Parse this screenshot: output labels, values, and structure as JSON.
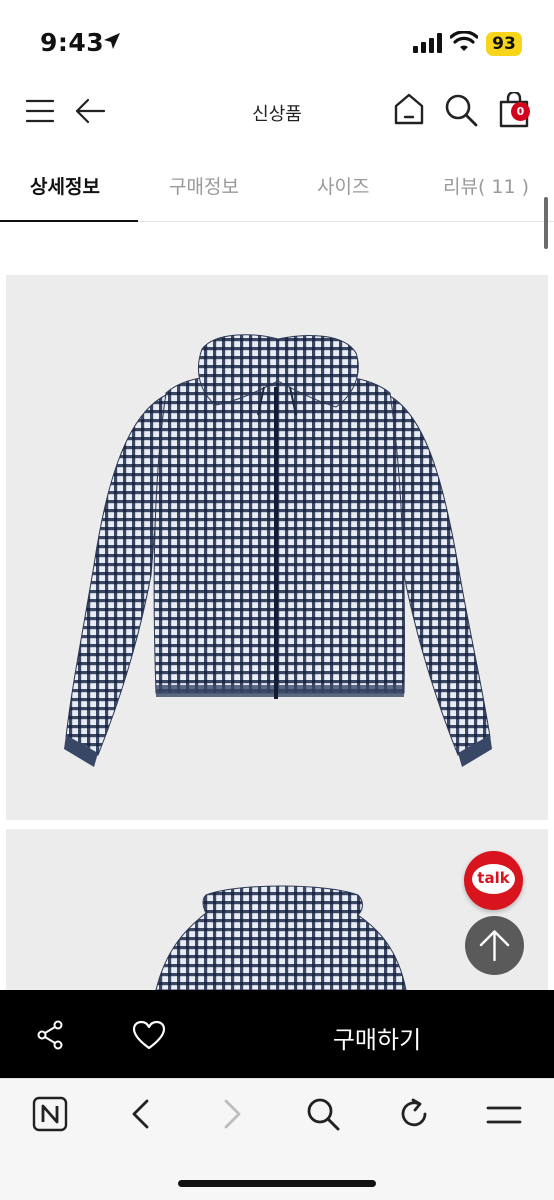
{
  "status_bar": {
    "time": "9:43",
    "battery": "93"
  },
  "nav": {
    "title": "신상품",
    "cart_count": "0"
  },
  "tabs": [
    {
      "label": "상세정보",
      "active": true
    },
    {
      "label": "구매정보",
      "active": false
    },
    {
      "label": "사이즈",
      "active": false
    },
    {
      "label": "리뷰( 11 )",
      "active": false
    }
  ],
  "floating": {
    "talk_label": "talk"
  },
  "buy_bar": {
    "buy_label": "구매하기"
  },
  "icons": [
    "location-arrow-icon",
    "signal-icon",
    "wifi-icon",
    "menu-icon",
    "back-arrow-icon",
    "home-icon",
    "search-icon",
    "shopping-bag-icon",
    "share-icon",
    "heart-icon",
    "arrow-up-icon",
    "naver-icon",
    "chevron-left-icon",
    "chevron-right-icon",
    "reload-icon",
    "hamburger-icon"
  ],
  "colors": {
    "accent": "#d5001c",
    "buy_bar": "#000000",
    "product_bg": "#ececec"
  }
}
